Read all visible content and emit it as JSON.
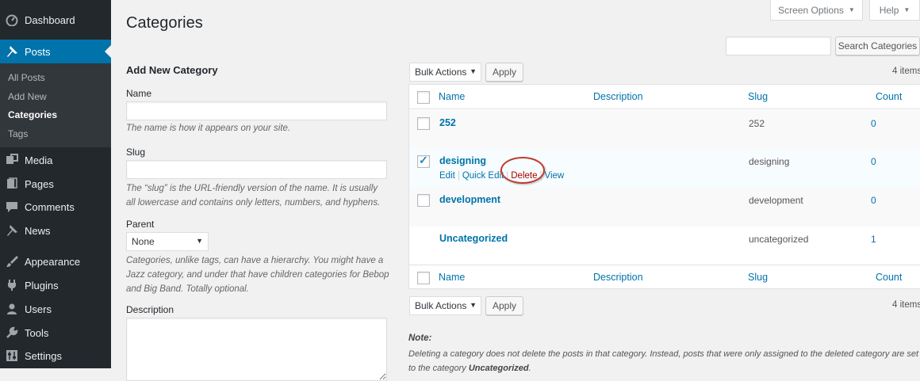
{
  "sidebar": {
    "top_items": [
      {
        "label": "Dashboard",
        "icon": "dashboard-icon"
      },
      {
        "label": "Posts",
        "icon": "pushpin-icon"
      }
    ],
    "posts_submenu": [
      "All Posts",
      "Add New",
      "Categories",
      "Tags"
    ],
    "items": [
      {
        "label": "Media",
        "icon": "media-icon"
      },
      {
        "label": "Pages",
        "icon": "pages-icon"
      },
      {
        "label": "Comments",
        "icon": "comment-icon"
      },
      {
        "label": "News",
        "icon": "pushpin-icon"
      },
      {
        "label": "Appearance",
        "icon": "brush-icon"
      },
      {
        "label": "Plugins",
        "icon": "plugin-icon"
      },
      {
        "label": "Users",
        "icon": "users-icon"
      },
      {
        "label": "Tools",
        "icon": "wrench-icon"
      },
      {
        "label": "Settings",
        "icon": "settings-icon"
      }
    ]
  },
  "header": {
    "title": "Categories",
    "screen_options": "Screen Options",
    "help": "Help",
    "search_button": "Search Categories",
    "search_value": ""
  },
  "form": {
    "heading": "Add New Category",
    "name_label": "Name",
    "name_value": "",
    "name_hint": "The name is how it appears on your site.",
    "slug_label": "Slug",
    "slug_value": "",
    "slug_hint": "The “slug” is the URL-friendly version of the name. It is usually all lowercase and contains only letters, numbers, and hyphens.",
    "parent_label": "Parent",
    "parent_selected": "None",
    "parent_hint": "Categories, unlike tags, can have a hierarchy. You might have a Jazz category, and under that have children categories for Bebop and Big Band. Totally optional.",
    "description_label": "Description"
  },
  "table": {
    "bulk_actions": "Bulk Actions",
    "apply": "Apply",
    "items_count": "4 items",
    "columns": [
      "Name",
      "Description",
      "Slug",
      "Count"
    ],
    "rows": [
      {
        "name": "252",
        "slug": "252",
        "count": "0",
        "checked": false
      },
      {
        "name": "designing",
        "slug": "designing",
        "count": "0",
        "checked": true
      },
      {
        "name": "development",
        "slug": "development",
        "count": "0",
        "checked": false
      },
      {
        "name": "Uncategorized",
        "slug": "uncategorized",
        "count": "1",
        "checked": false
      }
    ],
    "row_actions": [
      "Edit",
      "Quick Edit",
      "Delete",
      "View"
    ]
  },
  "note": {
    "label": "Note:",
    "text_before": "Deleting a category does not delete the posts in that category. Instead, posts that were only assigned to the deleted category are set to the category ",
    "text_bold": "Uncategorized",
    "text_after": "."
  },
  "colors": {
    "sidebar_bg": "#23282d",
    "accent": "#0073aa",
    "highlight_circle": "#c0392b",
    "delete_link": "#a00"
  }
}
